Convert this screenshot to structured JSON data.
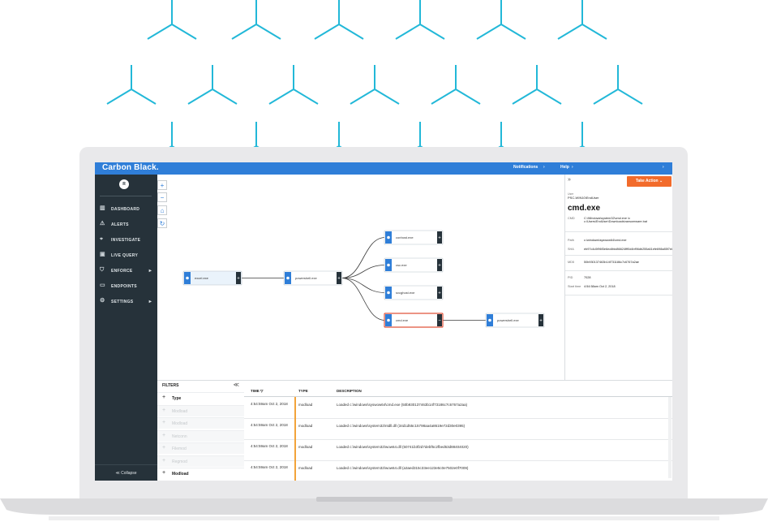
{
  "app": {
    "brand": "Carbon Black.",
    "nav": {
      "notifications": "Notifications",
      "help": "Help"
    },
    "accent": "#2f7ed8",
    "sidebar_bg": "#26323a",
    "action_color": "#f26b2b",
    "event_bar_color": "#f2a33a"
  },
  "sidebar": {
    "avatar": "R",
    "items": [
      {
        "label": "DASHBOARD",
        "icon": "bar-chart-icon",
        "glyph": "▥",
        "arrow": ""
      },
      {
        "label": "ALERTS",
        "icon": "warning-icon",
        "glyph": "⚠",
        "arrow": ""
      },
      {
        "label": "INVESTIGATE",
        "icon": "crosshair-icon",
        "glyph": "⌖",
        "arrow": ""
      },
      {
        "label": "LIVE QUERY",
        "icon": "terminal-icon",
        "glyph": "▣",
        "arrow": ""
      },
      {
        "label": "ENFORCE",
        "icon": "shield-icon",
        "glyph": "⛉",
        "arrow": "▸"
      },
      {
        "label": "ENDPOINTS",
        "icon": "monitor-icon",
        "glyph": "▭",
        "arrow": ""
      },
      {
        "label": "SETTINGS",
        "icon": "gear-icon",
        "glyph": "⚙",
        "arrow": "▸"
      }
    ],
    "collapse": "≪ Collapse"
  },
  "graph_controls": {
    "zoom_in": "+",
    "zoom_out": "−",
    "home": "⌂",
    "refresh": "↻"
  },
  "graph": {
    "nodes": [
      {
        "id": "n0",
        "label": "excel.exe"
      },
      {
        "id": "n1",
        "label": "powershell.exe"
      },
      {
        "id": "n2",
        "label": "conhost.exe"
      },
      {
        "id": "n3",
        "label": "csc.exe"
      },
      {
        "id": "n4",
        "label": "svcghost.exe"
      },
      {
        "id": "n5",
        "label": "cmd.exe"
      },
      {
        "id": "n6",
        "label": "powershell.exe"
      }
    ]
  },
  "details": {
    "take_action": "Take Action ⌄",
    "user_label": "User",
    "user": "PSC-WIN10\\EndUser",
    "title": "cmd.exe",
    "fields": [
      {
        "key": "CMD",
        "value": "C:\\Windows\\system32\\cmd.exe /c c:\\Users\\EndUser\\Downloads\\ransomware.bat"
      },
      {
        "key": "Path",
        "value": "c:\\windows\\syswow64\\cmd.exe"
      },
      {
        "key": "SHA",
        "value": "eb97c4c5f96f3e6ec6fdd86624fff0d4bf96db255a61efe698a85f7e8d5c71c9"
      },
      {
        "key": "MD5",
        "value": "50b930137463b14f731186c7c6767a2ae"
      },
      {
        "key": "PID",
        "value": "7028"
      },
      {
        "key": "Start time",
        "value": "4:54:58am Oct 2, 2018"
      }
    ]
  },
  "filters": {
    "title": "FILTERS",
    "collapse": "≪",
    "rows": [
      {
        "label": "Type",
        "dim": false
      },
      {
        "label": "Modload",
        "dim": true
      },
      {
        "label": "Modload",
        "dim": true
      },
      {
        "label": "Netconn",
        "dim": true
      },
      {
        "label": "Filemod",
        "dim": true
      },
      {
        "label": "Regmod",
        "dim": true
      },
      {
        "label": "Modload",
        "dim": false
      }
    ]
  },
  "events": {
    "headers": {
      "time": "TIME ▽",
      "type": "TYPE",
      "description": "DESCRIPTION"
    },
    "rows": [
      {
        "time": "4:54:59am Oct 2, 2018",
        "type": "modload",
        "description": "Loaded c:\\windows\\syswow64\\cmd.exe (50b930137463b14f73186c7c6767a2aa)"
      },
      {
        "time": "4:54:59am Oct 2, 2018",
        "type": "modload",
        "description": "Loaded c:\\windows\\system32\\ntdll.dll (34d1d55c15798aa4a8619e72d30e0395)"
      },
      {
        "time": "4:54:59am Oct 2, 2018",
        "type": "modload",
        "description": "Loaded c:\\windows\\system32\\wow64.dll (50741b3f2d7debf5c2fbed63d88404020)"
      },
      {
        "time": "4:54:59am Oct 2, 2018",
        "type": "modload",
        "description": "Loaded c:\\windows\\system32\\wow64.dll (a3aed315c33ee123e5c0e7502e0f7009)"
      }
    ]
  }
}
